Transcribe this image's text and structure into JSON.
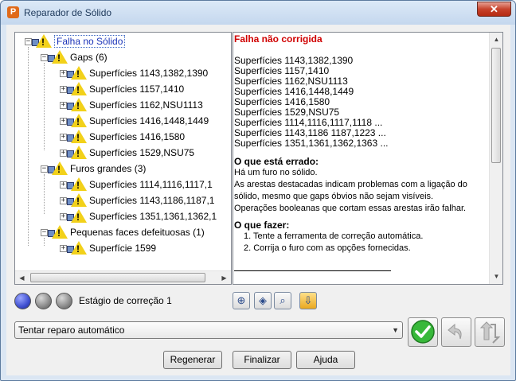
{
  "window": {
    "title": "Reparador de Sólido",
    "close_label": "✕",
    "app_icon_letter": "P"
  },
  "tree": {
    "root": "Falha no Sólido",
    "groups": [
      {
        "label": "Gaps (6)",
        "items": [
          "Superfícies 1143,1382,1390",
          "Superfícies 1157,1410",
          "Superfícies 1162,NSU1113",
          "Superfícies 1416,1448,1449",
          "Superfícies 1416,1580",
          "Superfícies 1529,NSU75"
        ]
      },
      {
        "label": "Furos grandes (3)",
        "items": [
          "Superfícies 1114,1116,1117,1",
          "Superfícies 1143,1186,1187,1",
          "Superfícies 1351,1361,1362,1"
        ]
      },
      {
        "label": "Pequenas faces defeituosas (1)",
        "items": [
          "Superfície 1599"
        ]
      }
    ]
  },
  "details": {
    "title": "Falha não corrigida",
    "surfaces": [
      "Superfícies 1143,1382,1390",
      "Superfícies 1157,1410",
      "Superfícies 1162,NSU1113",
      "Superfícies 1416,1448,1449",
      "Superfícies 1416,1580",
      "Superfícies 1529,NSU75",
      "Superfícies 1114,1116,1117,1118 ...",
      "Superfícies 1143,1186 1187,1223 ...",
      "Superfícies 1351,1361,1362,1363 ..."
    ],
    "wrong_heading": "O que está errado:",
    "wrong_lines": [
      "Há um furo no sólido.",
      "As arestas destacadas indicam problemas com a ligação do",
      "sólido, mesmo que gaps óbvios não sejam visíveis.",
      "Operações booleanas que cortam essas arestas irão falhar."
    ],
    "todo_heading": "O que fazer:",
    "todo_lines": [
      "1. Tente a ferramenta de correção automática.",
      "2. Corrija o furo com as opções fornecidas."
    ]
  },
  "stage": {
    "label": "Estágio de correção 1",
    "circle_colors": [
      "#3f4fd0",
      "#8a8a8a",
      "#8a8a8a"
    ]
  },
  "tools": {
    "icons": [
      "zoom-in-icon",
      "select-view-icon",
      "zoom-fit-icon",
      "export-icon"
    ]
  },
  "combo": {
    "value": "Tentar reparo automático"
  },
  "buttons": {
    "regenerate": "Regenerar",
    "finish": "Finalizar",
    "help": "Ajuda"
  },
  "colors": {
    "accent_green": "#38b83a",
    "error_red": "#d00000"
  }
}
